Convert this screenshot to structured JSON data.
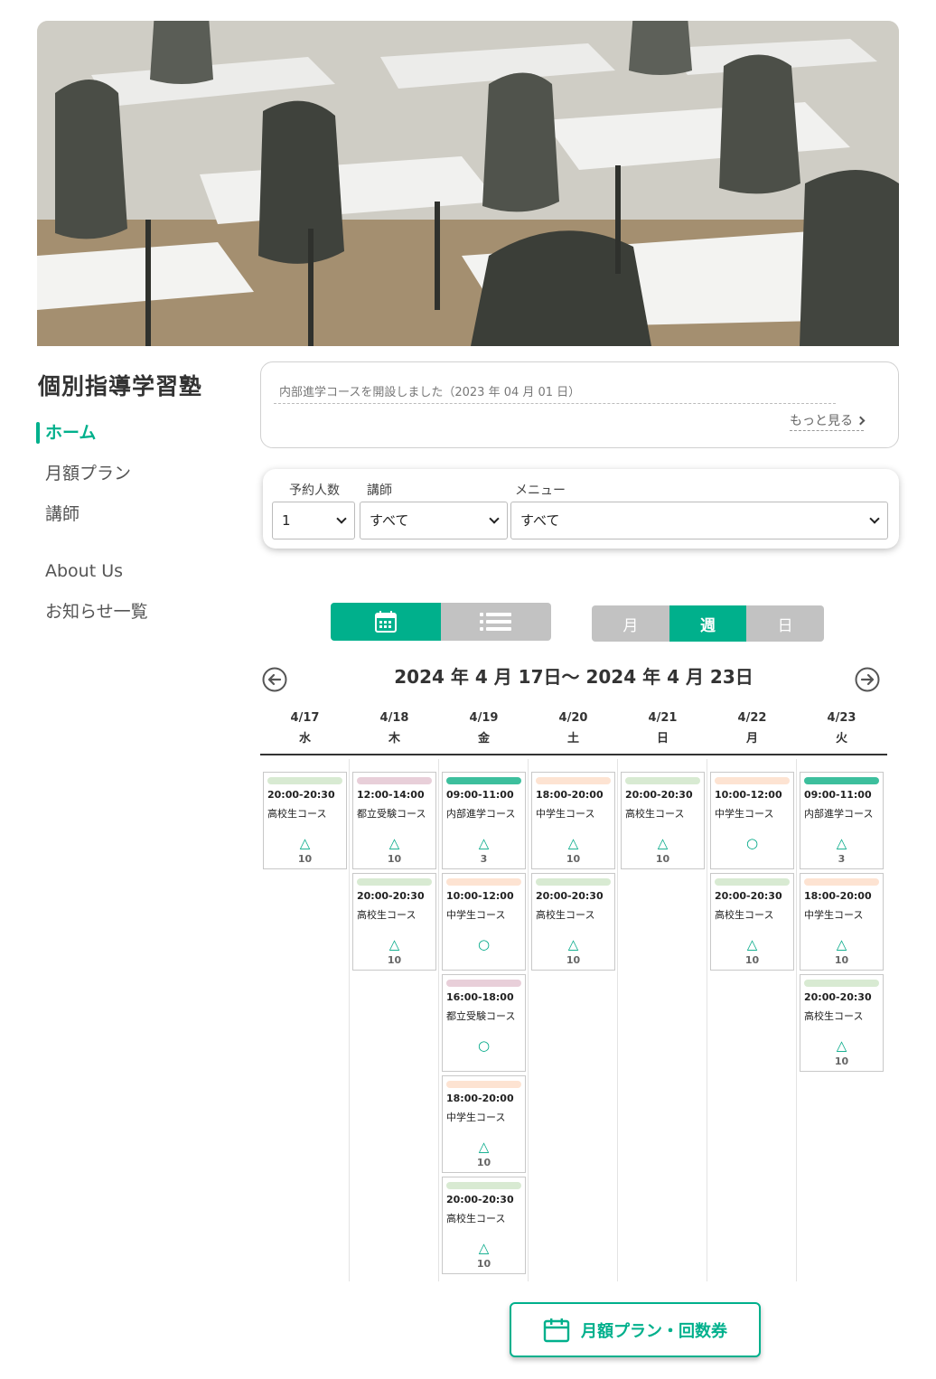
{
  "site": {
    "title": "個別指導学習塾"
  },
  "nav": {
    "items": [
      {
        "label": "ホーム",
        "active": true
      },
      {
        "label": "月額プラン",
        "active": false
      },
      {
        "label": "講師",
        "active": false
      },
      {
        "label": "About Us",
        "active": false
      },
      {
        "label": "お知らせ一覧",
        "active": false
      }
    ]
  },
  "news": {
    "item": "内部進学コースを開設しました（2023 年 04 月 01 日）",
    "more_label": "もっと見る"
  },
  "filters": {
    "people_label": "予約人数",
    "people_value": "1",
    "teacher_label": "講師",
    "teacher_value": "すべて",
    "menu_label": "メニュー",
    "menu_value": "すべて"
  },
  "period_toggle": {
    "month": "月",
    "week": "週",
    "day": "日",
    "selected": "週"
  },
  "calendar": {
    "range_title": "2024 年 4 月 17日〜 2024 年 4 月 23日",
    "days": [
      {
        "date": "4/17",
        "weekday": "水"
      },
      {
        "date": "4/18",
        "weekday": "木"
      },
      {
        "date": "4/19",
        "weekday": "金"
      },
      {
        "date": "4/20",
        "weekday": "土"
      },
      {
        "date": "4/21",
        "weekday": "日"
      },
      {
        "date": "4/22",
        "weekday": "月"
      },
      {
        "date": "4/23",
        "weekday": "火"
      }
    ],
    "course_colors": {
      "高校生コース": "#d8ead2",
      "都立受験コース": "#e8cfd9",
      "内部進学コース": "#3dbf9d",
      "中学生コース": "#fde3d2"
    },
    "slots": [
      [
        {
          "time": "20:00-20:30",
          "course": "高校生コース",
          "mark": "△",
          "count": "10"
        }
      ],
      [
        {
          "time": "12:00-14:00",
          "course": "都立受験コース",
          "mark": "△",
          "count": "10"
        },
        {
          "time": "20:00-20:30",
          "course": "高校生コース",
          "mark": "△",
          "count": "10"
        }
      ],
      [
        {
          "time": "09:00-11:00",
          "course": "内部進学コース",
          "mark": "△",
          "count": "3"
        },
        {
          "time": "10:00-12:00",
          "course": "中学生コース",
          "mark": "○",
          "count": ""
        },
        {
          "time": "16:00-18:00",
          "course": "都立受験コース",
          "mark": "○",
          "count": ""
        },
        {
          "time": "18:00-20:00",
          "course": "中学生コース",
          "mark": "△",
          "count": "10"
        },
        {
          "time": "20:00-20:30",
          "course": "高校生コース",
          "mark": "△",
          "count": "10"
        }
      ],
      [
        {
          "time": "18:00-20:00",
          "course": "中学生コース",
          "mark": "△",
          "count": "10"
        },
        {
          "time": "20:00-20:30",
          "course": "高校生コース",
          "mark": "△",
          "count": "10"
        }
      ],
      [
        {
          "time": "20:00-20:30",
          "course": "高校生コース",
          "mark": "△",
          "count": "10"
        }
      ],
      [
        {
          "time": "10:00-12:00",
          "course": "中学生コース",
          "mark": "○",
          "count": ""
        },
        {
          "time": "20:00-20:30",
          "course": "高校生コース",
          "mark": "△",
          "count": "10"
        }
      ],
      [
        {
          "time": "09:00-11:00",
          "course": "内部進学コース",
          "mark": "△",
          "count": "3"
        },
        {
          "time": "18:00-20:00",
          "course": "中学生コース",
          "mark": "△",
          "count": "10"
        },
        {
          "time": "20:00-20:30",
          "course": "高校生コース",
          "mark": "△",
          "count": "10"
        }
      ]
    ]
  },
  "cta": {
    "label": "月額プラン・回数券"
  },
  "colors": {
    "accent": "#00b08c",
    "inactive": "#c2c2c2"
  }
}
